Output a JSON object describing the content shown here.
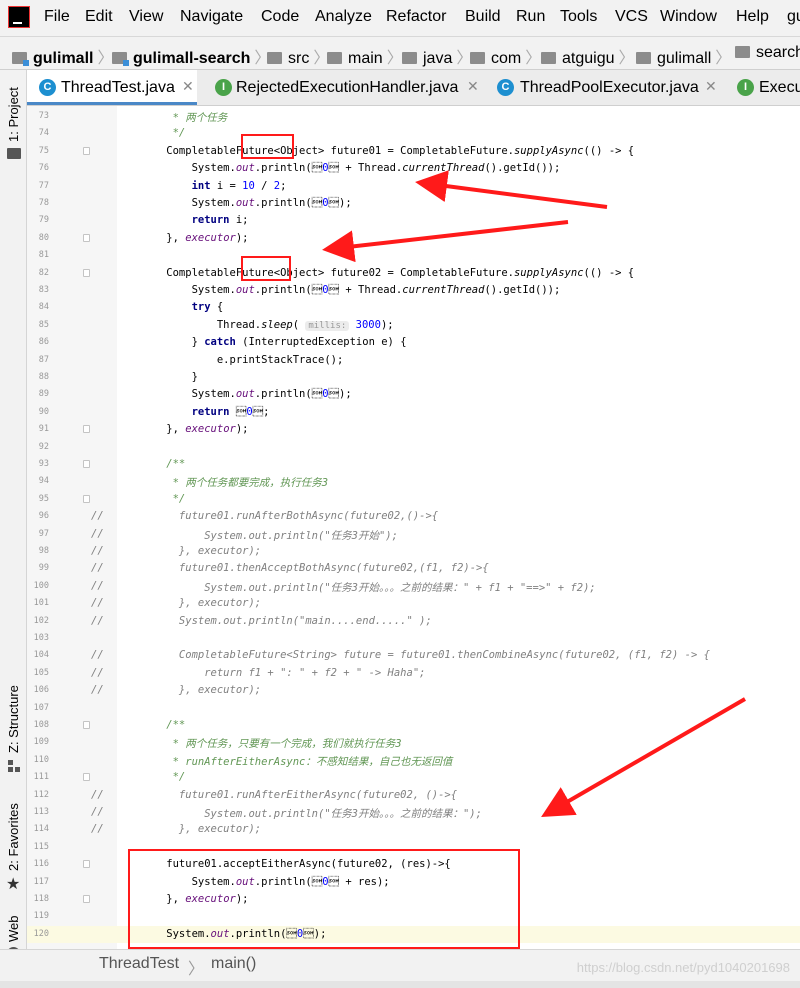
{
  "menu": [
    "File",
    "Edit",
    "View",
    "Navigate",
    "Code",
    "Analyze",
    "Refactor",
    "Build",
    "Run",
    "Tools",
    "VCS",
    "Window",
    "Help",
    "gu"
  ],
  "breadcrumb": [
    "gulimall",
    "gulimall-search",
    "src",
    "main",
    "java",
    "com",
    "atguigu",
    "gulimall",
    "search"
  ],
  "tabs": [
    "ThreadTest.java",
    "RejectedExecutionHandler.java",
    "ThreadPoolExecutor.java",
    "Execu"
  ],
  "sidebar": {
    "project": "1: Project",
    "structure": "Z: Structure",
    "favorites": "2: Favorites",
    "web": "Web"
  },
  "status": {
    "file": "ThreadTest",
    "method": "main()",
    "watermark": "https://blog.csdn.net/pyd1040201698"
  },
  "hint_millis": "millis:",
  "lines": [
    {
      "n": "73",
      "c": "",
      "t": "     * 两个任务"
    },
    {
      "n": "74",
      "c": "",
      "t": "     */"
    },
    {
      "n": "75",
      "c": "",
      "t": "    CompletableFuture<Object> future01 = CompletableFuture.supplyAsync(() -> {"
    },
    {
      "n": "76",
      "c": "",
      "t": "        System.out.println(\"任务1线程：\" + Thread.currentThread().getId());"
    },
    {
      "n": "77",
      "c": "",
      "t": "        int i = 10 / 2;"
    },
    {
      "n": "78",
      "c": "",
      "t": "        System.out.println(\"任务1结束：\");"
    },
    {
      "n": "79",
      "c": "",
      "t": "        return i;"
    },
    {
      "n": "80",
      "c": "",
      "t": "    }, executor);"
    },
    {
      "n": "81",
      "c": "",
      "t": ""
    },
    {
      "n": "82",
      "c": "",
      "t": "    CompletableFuture<Object> future02 = CompletableFuture.supplyAsync(() -> {"
    },
    {
      "n": "83",
      "c": "",
      "t": "        System.out.println(\"任务2线程：\" + Thread.currentThread().getId());"
    },
    {
      "n": "84",
      "c": "",
      "t": "        try {"
    },
    {
      "n": "85",
      "c": "",
      "t": "            Thread.sleep( 3000);"
    },
    {
      "n": "86",
      "c": "",
      "t": "        } catch (InterruptedException e) {"
    },
    {
      "n": "87",
      "c": "",
      "t": "            e.printStackTrace();"
    },
    {
      "n": "88",
      "c": "",
      "t": "        }"
    },
    {
      "n": "89",
      "c": "",
      "t": "        System.out.println(\"任务2结束：\");"
    },
    {
      "n": "90",
      "c": "",
      "t": "        return \"Hello\";"
    },
    {
      "n": "91",
      "c": "",
      "t": "    }, executor);"
    },
    {
      "n": "92",
      "c": "",
      "t": ""
    },
    {
      "n": "93",
      "c": "",
      "t": "    /**"
    },
    {
      "n": "94",
      "c": "",
      "t": "     * 两个任务都要完成，执行任务3"
    },
    {
      "n": "95",
      "c": "",
      "t": "     */"
    },
    {
      "n": "96",
      "c": "//",
      "t": "      future01.runAfterBothAsync(future02,()->{"
    },
    {
      "n": "97",
      "c": "//",
      "t": "          System.out.println(\"任务3开始\");"
    },
    {
      "n": "98",
      "c": "//",
      "t": "      }, executor);"
    },
    {
      "n": "99",
      "c": "//",
      "t": "      future01.thenAcceptBothAsync(future02,(f1, f2)->{"
    },
    {
      "n": "100",
      "c": "//",
      "t": "          System.out.println(\"任务3开始。。。之前的结果：\" + f1 + \"==>\" + f2);"
    },
    {
      "n": "101",
      "c": "//",
      "t": "      }, executor);"
    },
    {
      "n": "102",
      "c": "//",
      "t": "      System.out.println(\"main....end.....\" );"
    },
    {
      "n": "103",
      "c": "",
      "t": ""
    },
    {
      "n": "104",
      "c": "//",
      "t": "      CompletableFuture<String> future = future01.thenCombineAsync(future02, (f1, f2) -> {"
    },
    {
      "n": "105",
      "c": "//",
      "t": "          return f1 + \": \" + f2 + \" -> Haha\";"
    },
    {
      "n": "106",
      "c": "//",
      "t": "      }, executor);"
    },
    {
      "n": "107",
      "c": "",
      "t": ""
    },
    {
      "n": "108",
      "c": "",
      "t": "    /**"
    },
    {
      "n": "109",
      "c": "",
      "t": "     * 两个任务，只要有一个完成，我们就执行任务3"
    },
    {
      "n": "110",
      "c": "",
      "t": "     * runAfterEitherAsync：不感知结果，自己也无返回值"
    },
    {
      "n": "111",
      "c": "",
      "t": "     */"
    },
    {
      "n": "112",
      "c": "//",
      "t": "      future01.runAfterEitherAsync(future02, ()->{"
    },
    {
      "n": "113",
      "c": "//",
      "t": "          System.out.println(\"任务3开始。。。之前的结果：\");"
    },
    {
      "n": "114",
      "c": "//",
      "t": "      }, executor);"
    },
    {
      "n": "115",
      "c": "",
      "t": ""
    },
    {
      "n": "116",
      "c": "",
      "t": "    future01.acceptEitherAsync(future02, (res)->{"
    },
    {
      "n": "117",
      "c": "",
      "t": "        System.out.println(\"任务3开始。。。之前的结果：\" + res);"
    },
    {
      "n": "118",
      "c": "",
      "t": "    }, executor);"
    },
    {
      "n": "119",
      "c": "",
      "t": ""
    },
    {
      "n": "120",
      "c": "",
      "t": "    System.out.println(\"main....end.....\");"
    }
  ]
}
